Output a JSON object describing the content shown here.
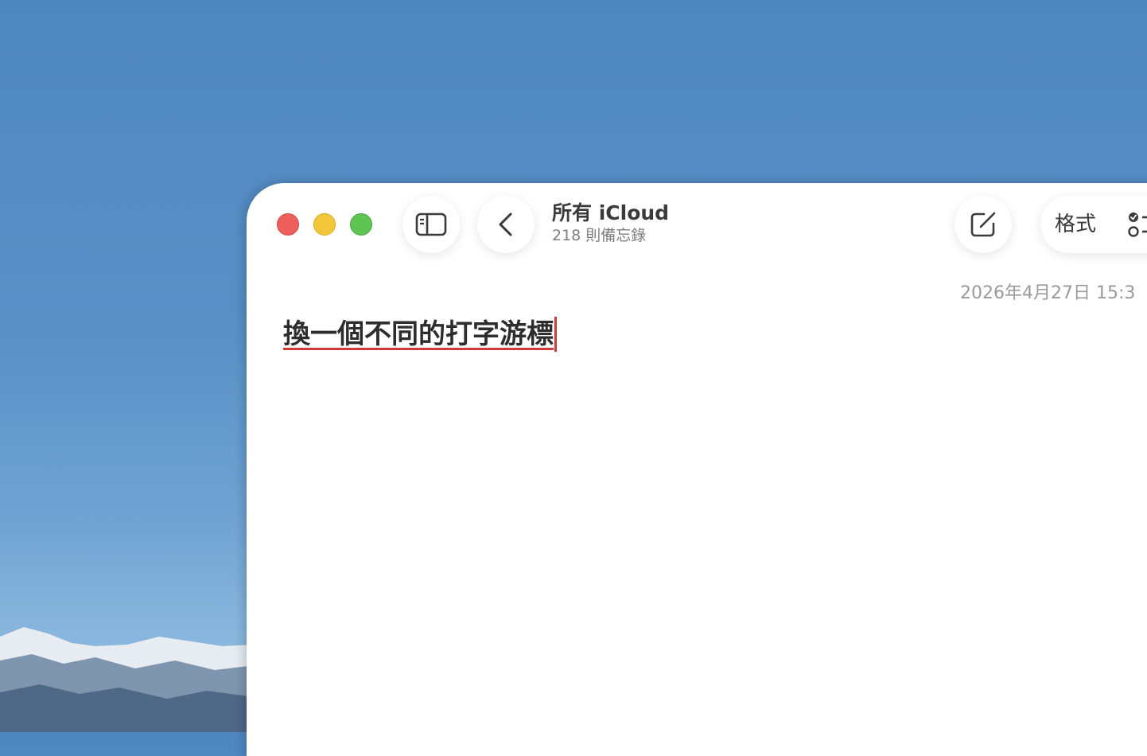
{
  "window": {
    "title": "所有 iCloud",
    "subtitle": "218 則備忘錄"
  },
  "toolbar": {
    "sidebar_icon": "sidebar-icon",
    "back_icon": "chevron-left-icon",
    "compose_icon": "compose-icon",
    "format_label": "格式",
    "checklist_icon": "checklist-icon"
  },
  "note": {
    "date": "2026年4月27日 15:3",
    "title": "換一個不同的打字游標"
  },
  "colors": {
    "close": "#ec5f5c",
    "minimize": "#f4c63a",
    "maximize": "#5ec454",
    "caret": "#d03a3a"
  }
}
